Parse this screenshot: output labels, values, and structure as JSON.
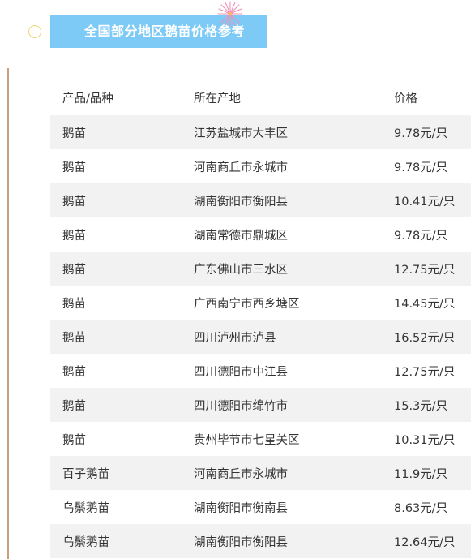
{
  "title": "全国部分地区鹅苗价格参考",
  "colors": {
    "banner": "#7ccaf5",
    "row_shade": "#f2f2f2",
    "left_line": "#c9a07d",
    "circle": "#f3d36b"
  },
  "table": {
    "headers": [
      "产品/品种",
      "所在产地",
      "价格"
    ],
    "rows": [
      [
        "鹅苗",
        "江苏盐城市大丰区",
        "9.78元/只"
      ],
      [
        "鹅苗",
        "河南商丘市永城市",
        "9.78元/只"
      ],
      [
        "鹅苗",
        "湖南衡阳市衡阳县",
        "10.41元/只"
      ],
      [
        "鹅苗",
        "湖南常德市鼎城区",
        "9.78元/只"
      ],
      [
        "鹅苗",
        "广东佛山市三水区",
        "12.75元/只"
      ],
      [
        "鹅苗",
        "广西南宁市西乡塘区",
        "14.45元/只"
      ],
      [
        "鹅苗",
        "四川泸州市泸县",
        "16.52元/只"
      ],
      [
        "鹅苗",
        "四川德阳市中江县",
        "12.75元/只"
      ],
      [
        "鹅苗",
        "四川德阳市绵竹市",
        "15.3元/只"
      ],
      [
        "鹅苗",
        "贵州毕节市七星关区",
        "10.31元/只"
      ],
      [
        "百子鹅苗",
        "河南商丘市永城市",
        "11.9元/只"
      ],
      [
        "乌鬃鹅苗",
        "湖南衡阳市衡南县",
        "8.63元/只"
      ],
      [
        "乌鬃鹅苗",
        "湖南衡阳市衡阳县",
        "12.64元/只"
      ]
    ]
  }
}
